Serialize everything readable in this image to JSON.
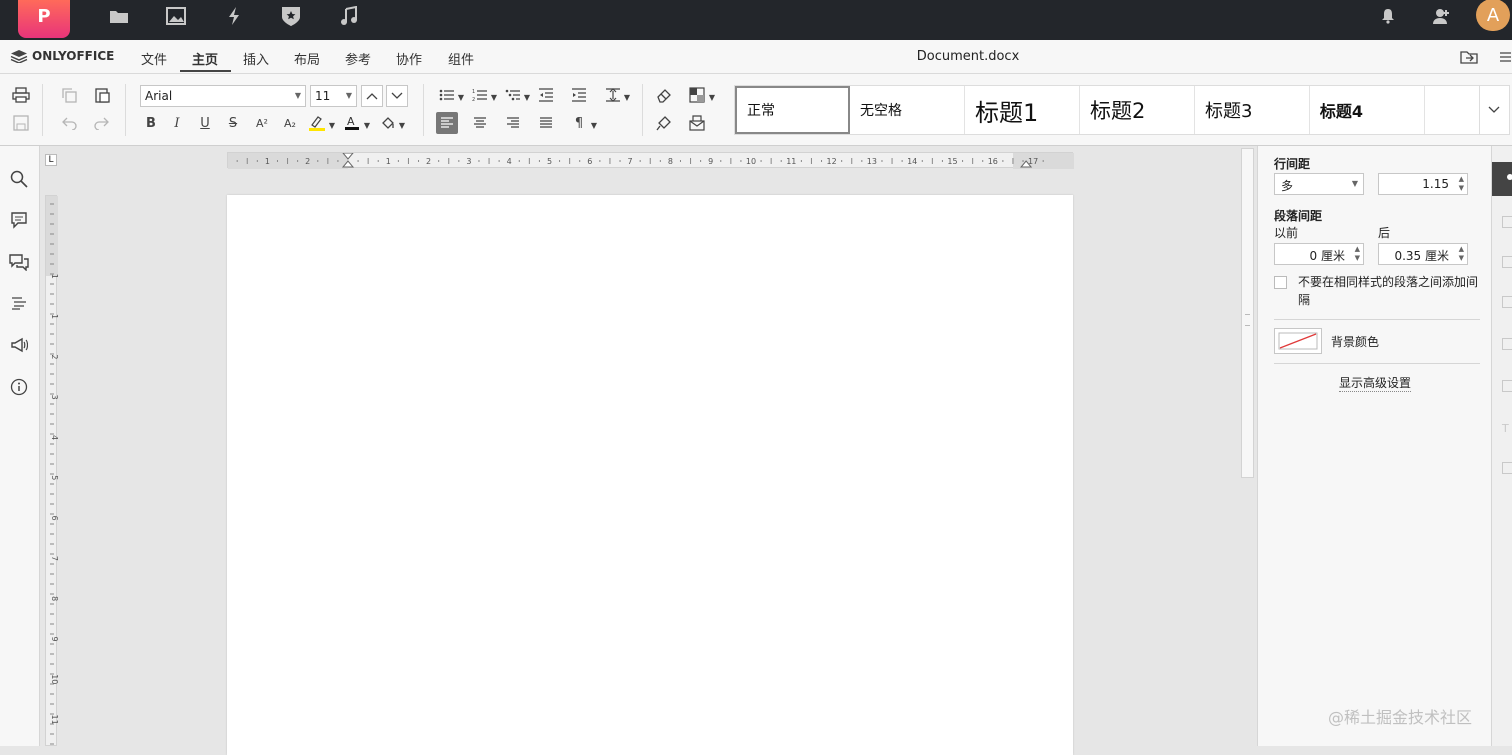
{
  "topbar": {
    "logo_letter": "P",
    "icons": [
      "folder-icon",
      "image-icon",
      "bolt-icon",
      "shield-icon",
      "music-icon"
    ],
    "right_icons": [
      "bell-icon",
      "user-icon"
    ],
    "avatar_letter": "A"
  },
  "menubar": {
    "brand": "ONLYOFFICE",
    "tabs": [
      "文件",
      "主页",
      "插入",
      "布局",
      "参考",
      "协作",
      "组件"
    ],
    "active_tab": "主页",
    "doc_title": "Document.docx"
  },
  "toolbar": {
    "font_name": "Arial",
    "font_size": "11",
    "styles": [
      "正常",
      "无空格",
      "标题1",
      "标题2",
      "标题3",
      "标题4"
    ]
  },
  "ruler": {
    "h_left_marks": [
      "2",
      "1"
    ],
    "h_marks": [
      "1",
      "2",
      "3",
      "4",
      "5",
      "6",
      "7",
      "8",
      "9",
      "10",
      "11",
      "12",
      "13",
      "14",
      "15",
      "16",
      "17"
    ],
    "v_marks": [
      "1",
      "1",
      "2",
      "3",
      "4",
      "5",
      "6",
      "7",
      "8",
      "9",
      "10",
      "11"
    ],
    "corner_icon": "L"
  },
  "left_sidebar": {
    "icons": [
      "search-icon",
      "comment-icon",
      "chat-icon",
      "headings-icon",
      "feedback-icon",
      "info-icon"
    ]
  },
  "right_panel": {
    "line_spacing_label": "行间距",
    "line_spacing_mode": "多",
    "line_spacing_value": "1.15",
    "para_spacing_label": "段落间距",
    "before_label": "以前",
    "after_label": "后",
    "before_value": "0 厘米",
    "after_value": "0.35 厘米",
    "no_space_checkbox_label": "不要在相同样式的段落之间添加间隔",
    "no_space_checked": false,
    "bg_color_label": "背景颜色",
    "advanced_link": "显示高级设置"
  },
  "watermark": "@稀土掘金技术社区",
  "colors": {
    "topbar": "#23262b",
    "logo_gradient_top": "#ff6a5a",
    "logo_gradient_bottom": "#e8347a",
    "avatar": "#e2a05a",
    "toolbar_bg": "#f7f7f7",
    "canvas_bg": "#e6e6e6"
  }
}
